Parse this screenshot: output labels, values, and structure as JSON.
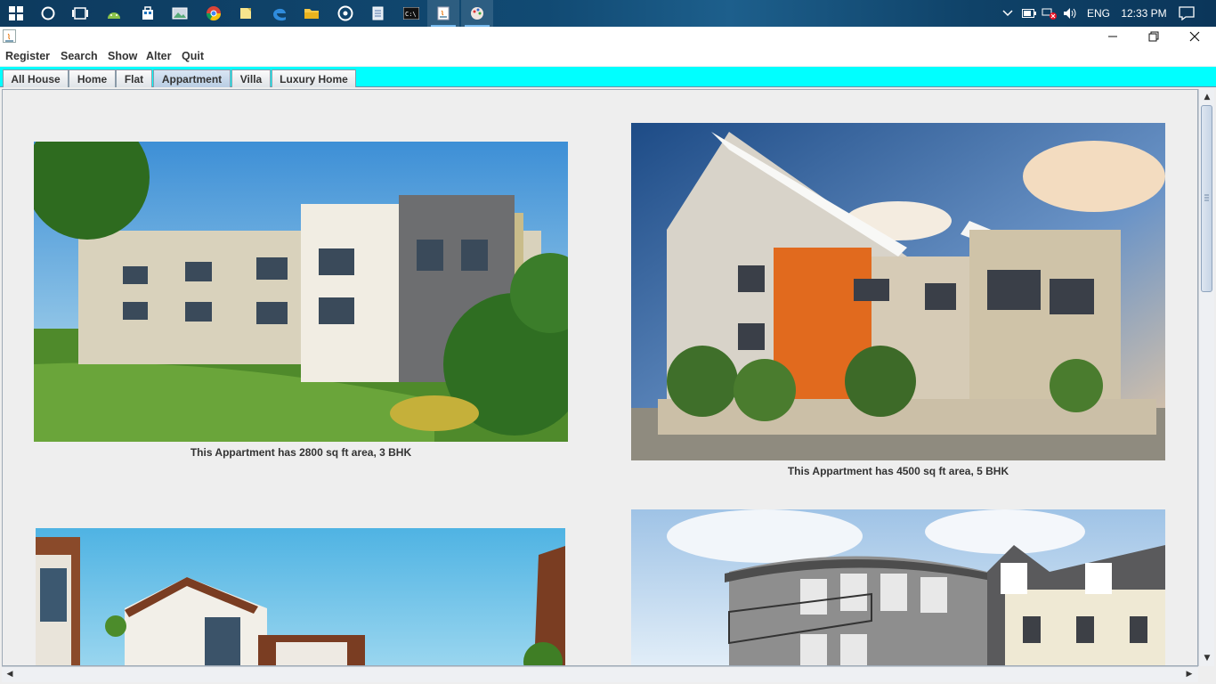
{
  "taskbar": {
    "tray": {
      "language": "ENG",
      "time": "12:33 PM"
    }
  },
  "menu": {
    "register": "Register",
    "search": "Search",
    "show": "Show",
    "alter": "Alter",
    "quit": "Quit"
  },
  "tabs": [
    {
      "label": "All House"
    },
    {
      "label": "Home"
    },
    {
      "label": "Flat"
    },
    {
      "label": "Appartment"
    },
    {
      "label": "Villa"
    },
    {
      "label": "Luxury Home"
    }
  ],
  "selected_tab": "Appartment",
  "listings": [
    {
      "caption": "This Appartment has 2800 sq ft area, 3 BHK"
    },
    {
      "caption": "This Appartment has 4500 sq ft area, 5 BHK"
    },
    {
      "caption": ""
    },
    {
      "caption": ""
    }
  ],
  "colors": {
    "tab_strip_bg": "#00ffff",
    "taskbar_bg": "#0d3a5e",
    "content_bg": "#eeeeee",
    "selected_tab_bg": "#b9cde3"
  }
}
